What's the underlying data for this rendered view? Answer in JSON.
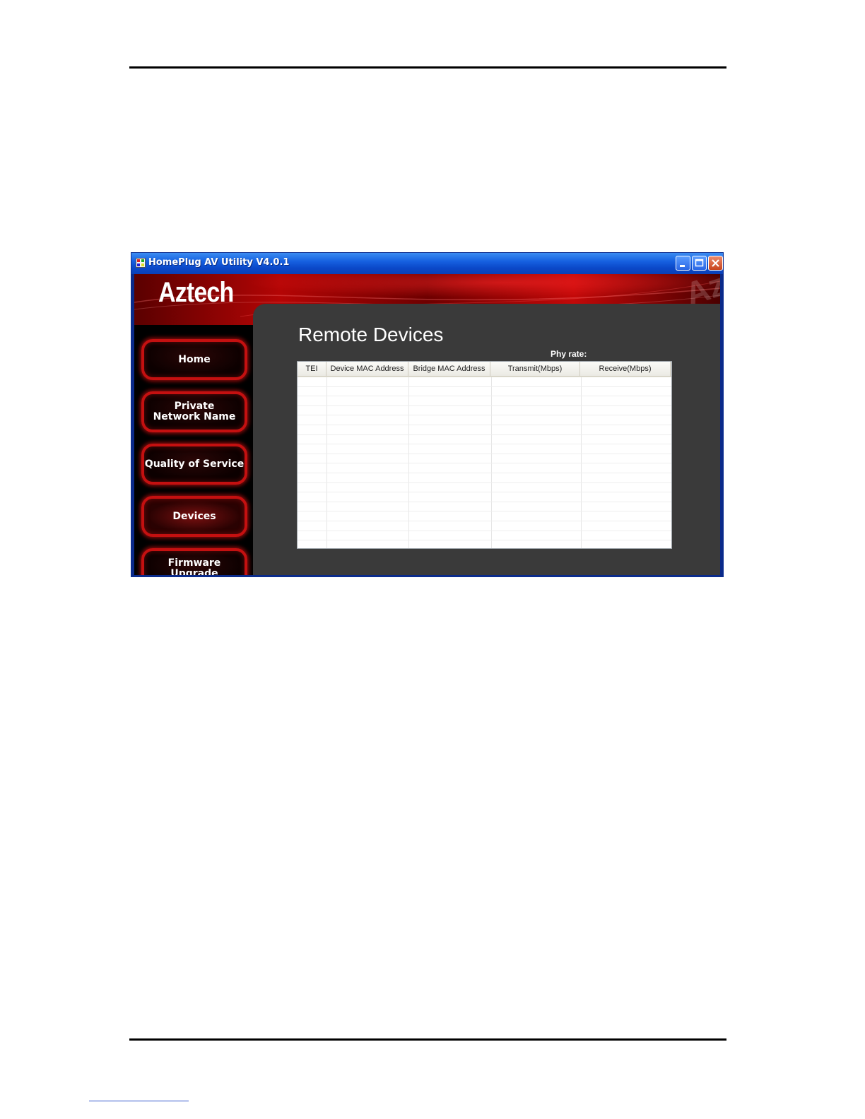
{
  "window": {
    "title": "HomePlug AV Utility V4.0.1"
  },
  "banner": {
    "logo": "Aztech",
    "watermark": "Az"
  },
  "sidebar": {
    "items": [
      {
        "label": "Home",
        "active": false
      },
      {
        "label": "Private\nNetwork Name",
        "active": false
      },
      {
        "label": "Quality of Service",
        "active": false
      },
      {
        "label": "Devices",
        "active": true
      },
      {
        "label": "Firmware Upgrade",
        "active": false
      }
    ]
  },
  "main": {
    "title": "Remote Devices",
    "phy_rate_label": "Phy rate:",
    "table": {
      "columns": [
        "TEI",
        "Device MAC Address",
        "Bridge MAC Address",
        "Transmit(Mbps)",
        "Receive(Mbps)"
      ],
      "rows": []
    }
  },
  "colors": {
    "accent_red": "#c41010",
    "titlebar_blue": "#0b49c9",
    "content_bg": "#3a3a3a"
  }
}
